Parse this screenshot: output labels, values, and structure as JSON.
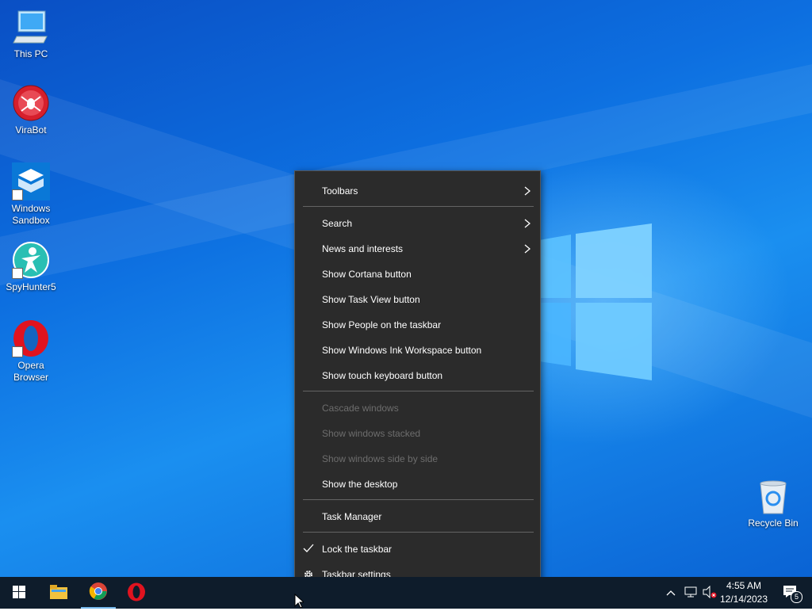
{
  "desktop_icons": [
    {
      "label": "This PC"
    },
    {
      "label": "ViraBot"
    },
    {
      "label": "Windows Sandbox"
    },
    {
      "label": "SpyHunter5"
    },
    {
      "label": "Opera Browser"
    },
    {
      "label": "Recycle Bin"
    }
  ],
  "context_menu": {
    "items": [
      {
        "label": "Toolbars",
        "submenu": true
      },
      {
        "label": "Search",
        "submenu": true
      },
      {
        "label": "News and interests",
        "submenu": true
      },
      {
        "label": "Show Cortana button"
      },
      {
        "label": "Show Task View button"
      },
      {
        "label": "Show People on the taskbar"
      },
      {
        "label": "Show Windows Ink Workspace button"
      },
      {
        "label": "Show touch keyboard button"
      },
      {
        "label": "Cascade windows",
        "disabled": true
      },
      {
        "label": "Show windows stacked",
        "disabled": true
      },
      {
        "label": "Show windows side by side",
        "disabled": true
      },
      {
        "label": "Show the desktop"
      },
      {
        "label": "Task Manager"
      },
      {
        "label": "Lock the taskbar",
        "checked": true
      },
      {
        "label": "Taskbar settings",
        "icon": "gear-icon"
      }
    ]
  },
  "taskbar": {
    "apps": [
      "start-icon",
      "file-explorer-icon",
      "chrome-icon",
      "opera-icon"
    ],
    "tray_icons": [
      "chevron-up-icon",
      "network-icon",
      "volume-muted-icon",
      "notifications-icon"
    ],
    "time": "4:55 AM",
    "date": "12/14/2023",
    "notification_count": "5"
  },
  "colors": {
    "menu_bg": "#2b2b2b",
    "taskbar_bg": "#0e1c2b",
    "desktop_blue": "#0d6fe0"
  }
}
